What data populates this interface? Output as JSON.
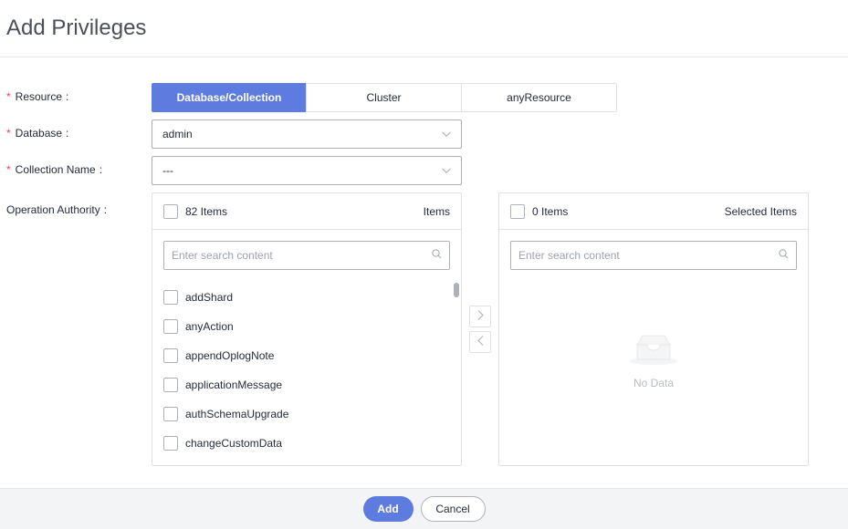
{
  "dialog": {
    "title": "Add Privileges"
  },
  "form": {
    "resource": {
      "label": "Resource",
      "options": [
        "Database/Collection",
        "Cluster",
        "anyResource"
      ],
      "selected": "Database/Collection"
    },
    "database": {
      "label": "Database",
      "value": "admin"
    },
    "collection": {
      "label": "Collection Name",
      "value": "---"
    },
    "operation": {
      "label": "Operation Authority"
    },
    "colon": ":"
  },
  "transfer": {
    "source": {
      "count": "82 Items",
      "title": "Items",
      "search_placeholder": "Enter search content",
      "items": [
        "addShard",
        "anyAction",
        "appendOplogNote",
        "applicationMessage",
        "authSchemaUpgrade",
        "changeCustomData"
      ]
    },
    "target": {
      "count": "0 Items",
      "title": "Selected Items",
      "search_placeholder": "Enter search content",
      "empty_text": "No Data"
    }
  },
  "footer": {
    "add_label": "Add",
    "cancel_label": "Cancel"
  },
  "colors": {
    "primary": "#5e7ce0",
    "required": "#e54545",
    "border": "#dfe1e6"
  }
}
